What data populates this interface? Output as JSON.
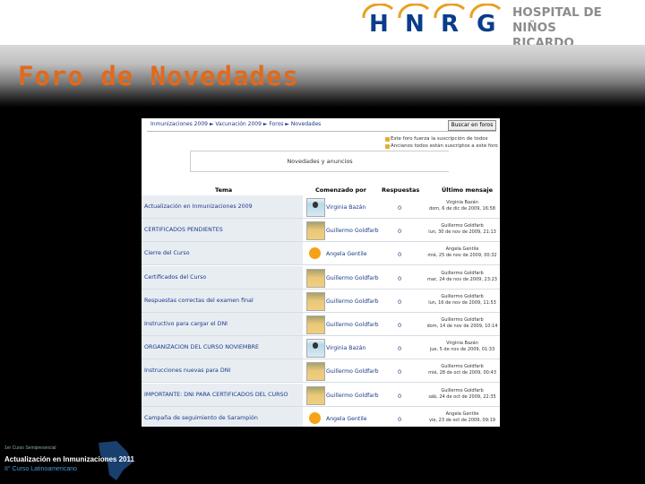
{
  "header": {
    "logo_letters": [
      "H",
      "N",
      "R",
      "G"
    ],
    "hospital_line1": "HOSPITAL DE NIÑOS",
    "hospital_line2": "RICARDO GUTIÉRREZ",
    "brand_color": "#0b3c8c"
  },
  "slide_title": "Foro de Novedades",
  "forum": {
    "breadcrumb": "Inmunizaciones 2009 ► Vacunación 2009 ► Foros ► Novedades",
    "search_button": "Buscar en foros",
    "subscription_line1": "Este foro fuerza la suscripción de todos",
    "subscription_line2": "Ancianos todos están suscriptos a este foro",
    "subject": "Novedades y anuncios",
    "columns": [
      "Tema",
      "Comenzado por",
      "Respuestas",
      "Último mensaje"
    ],
    "rows": [
      {
        "topic": "Actualización en Inmunizaciones 2009",
        "author": "Virginia Bazán",
        "avatar": "girl-photo",
        "replies": "0",
        "last_by": "Virginia Bazán",
        "last_date": "dom, 6 de dic de 2009, 16:58"
      },
      {
        "topic": "CERTIFICADOS PENDIENTES",
        "author": "Guillermo Goldfarb",
        "avatar": "man-photo",
        "replies": "0",
        "last_by": "Guillermo Goldfarb",
        "last_date": "lun, 30 de nov de 2009, 21:13"
      },
      {
        "topic": "Cierre del Curso",
        "author": "Angela Gentile",
        "avatar": "smiley-icon",
        "replies": "0",
        "last_by": "Angela Gentile",
        "last_date": "mié, 25 de nov de 2009, 00:32"
      },
      {
        "topic": "Certificados del Curso",
        "author": "Guillermo Goldfarb",
        "avatar": "man-photo",
        "replies": "0",
        "last_by": "Guillermo Goldfarb",
        "last_date": "mar, 24 de nov de 2009, 23:23"
      },
      {
        "topic": "Respuestas correctas del examen final",
        "author": "Guillermo Goldfarb",
        "avatar": "man-photo",
        "replies": "0",
        "last_by": "Guillermo Goldfarb",
        "last_date": "lun, 16 de nov de 2009, 11:53"
      },
      {
        "topic": "Instructivo para cargar el DNI",
        "author": "Guillermo Goldfarb",
        "avatar": "man-photo",
        "replies": "0",
        "last_by": "Guillermo Goldfarb",
        "last_date": "dom, 14 de nov de 2009, 10:14"
      },
      {
        "topic": "ORGANIZACION DEL CURSO NOVIEMBRE",
        "author": "Virginia Bazán",
        "avatar": "girl-photo",
        "replies": "0",
        "last_by": "Virginia Bazán",
        "last_date": "jue, 5 de nov de 2009, 01:33"
      },
      {
        "topic": "Instrucciones nuevas para DNI",
        "author": "Guillermo Goldfarb",
        "avatar": "man-photo",
        "replies": "0",
        "last_by": "Guillermo Goldfarb",
        "last_date": "mié, 28 de oct de 2009, 00:43"
      },
      {
        "topic": "IMPORTANTE: DNI PARA CERTIFICADOS DEL CURSO",
        "author": "Guillermo Goldfarb",
        "avatar": "man-photo",
        "replies": "0",
        "last_by": "Guillermo Goldfarb",
        "last_date": "sáb, 24 de oct de 2009, 22:35"
      },
      {
        "topic": "Campaña de seguimiento de Sarampión",
        "author": "Angela Gentile",
        "avatar": "smiley-icon",
        "replies": "0",
        "last_by": "Angela Gentile",
        "last_date": "vie, 23 de oct de 2009, 09:19"
      }
    ]
  },
  "footer": {
    "line1": "1er Curso Semipresencial",
    "line2": "Actualización en Inmunizaciones 2011",
    "line3": "II° Curso Latinoamericano"
  }
}
